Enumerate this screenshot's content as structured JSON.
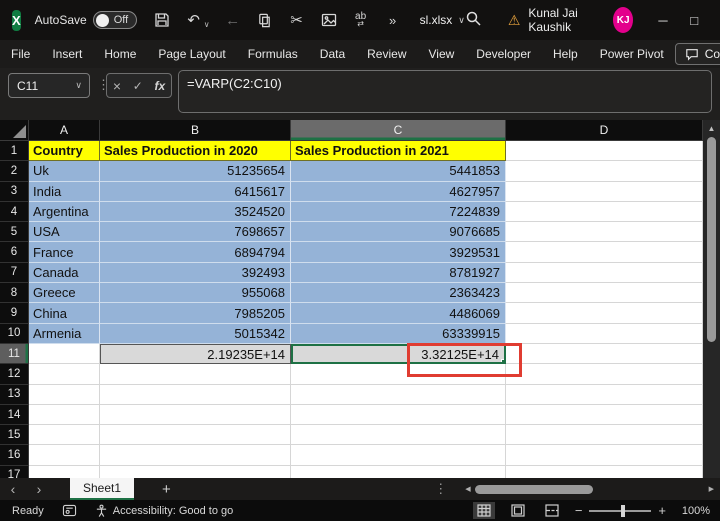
{
  "colors": {
    "selection-green": "#1E7145",
    "accent-green": "#21A366",
    "highlight-blue": "#95B3D7",
    "header-yellow": "#FFFF00",
    "result-gray": "#D9D9D9",
    "annotation-red": "#E03C31",
    "avatar-pink": "#E3008C"
  },
  "icons": {
    "excel_logo": "X",
    "back_arrow": "←",
    "undo": "↶",
    "cut": "✂",
    "replace": "ab",
    "overflow": "»",
    "chevron_down": "∨",
    "warning": "⚠",
    "minimize": "─",
    "maximize": "□",
    "close": "×",
    "cancel": "×",
    "enter": "✓",
    "fx": "fx",
    "dots": "⋮",
    "tab_prev": "‹",
    "tab_next": "›",
    "scroll_left": "◀",
    "scroll_right": "▶",
    "scroll_up": "▲",
    "minus": "−",
    "plus": "+",
    "add_sheet": "+"
  },
  "titlebar": {
    "autosave_label": "AutoSave",
    "autosave_state": "Off",
    "filename": "sl.xlsx",
    "user_name": "Kunal Jai Kaushik",
    "user_initials": "KJ"
  },
  "ribbon": {
    "tabs": [
      "File",
      "Insert",
      "Home",
      "Page Layout",
      "Formulas",
      "Data",
      "Review",
      "View",
      "Developer",
      "Help",
      "Power Pivot"
    ],
    "comments_label": "Comments"
  },
  "formula_bar": {
    "cell_ref": "C11",
    "formula": "=VARP(C2:C10)"
  },
  "grid": {
    "columns": [
      "A",
      "B",
      "C",
      "D"
    ],
    "selection": {
      "column": "C",
      "row": 11,
      "ref": "C11"
    },
    "rows": [
      {
        "num": "1",
        "a": "Country",
        "b": "Sales Production in 2020",
        "c": "Sales Production in 2021",
        "d": ""
      },
      {
        "num": "2",
        "a": "Uk",
        "b": "51235654",
        "c": "5441853",
        "d": ""
      },
      {
        "num": "3",
        "a": "India",
        "b": "6415617",
        "c": "4627957",
        "d": ""
      },
      {
        "num": "4",
        "a": "Argentina",
        "b": "3524520",
        "c": "7224839",
        "d": ""
      },
      {
        "num": "5",
        "a": "USA",
        "b": "7698657",
        "c": "9076685",
        "d": ""
      },
      {
        "num": "6",
        "a": "France",
        "b": "6894794",
        "c": "3929531",
        "d": ""
      },
      {
        "num": "7",
        "a": "Canada",
        "b": "392493",
        "c": "8781927",
        "d": ""
      },
      {
        "num": "8",
        "a": "Greece",
        "b": "955068",
        "c": "2363423",
        "d": ""
      },
      {
        "num": "9",
        "a": "China",
        "b": "7985205",
        "c": "4486069",
        "d": ""
      },
      {
        "num": "10",
        "a": "Armenia",
        "b": "5015342",
        "c": "63339915",
        "d": ""
      },
      {
        "num": "11",
        "a": "",
        "b": "2.19235E+14",
        "c": "3.32125E+14",
        "d": ""
      },
      {
        "num": "12",
        "a": "",
        "b": "",
        "c": "",
        "d": ""
      },
      {
        "num": "13",
        "a": "",
        "b": "",
        "c": "",
        "d": ""
      },
      {
        "num": "14",
        "a": "",
        "b": "",
        "c": "",
        "d": ""
      },
      {
        "num": "15",
        "a": "",
        "b": "",
        "c": "",
        "d": ""
      },
      {
        "num": "16",
        "a": "",
        "b": "",
        "c": "",
        "d": ""
      },
      {
        "num": "17",
        "a": "",
        "b": "",
        "c": "",
        "d": ""
      }
    ]
  },
  "sheetbar": {
    "active_tab": "Sheet1"
  },
  "statusbar": {
    "mode": "Ready",
    "accessibility": "Accessibility: Good to go",
    "zoom_level": "100%"
  }
}
